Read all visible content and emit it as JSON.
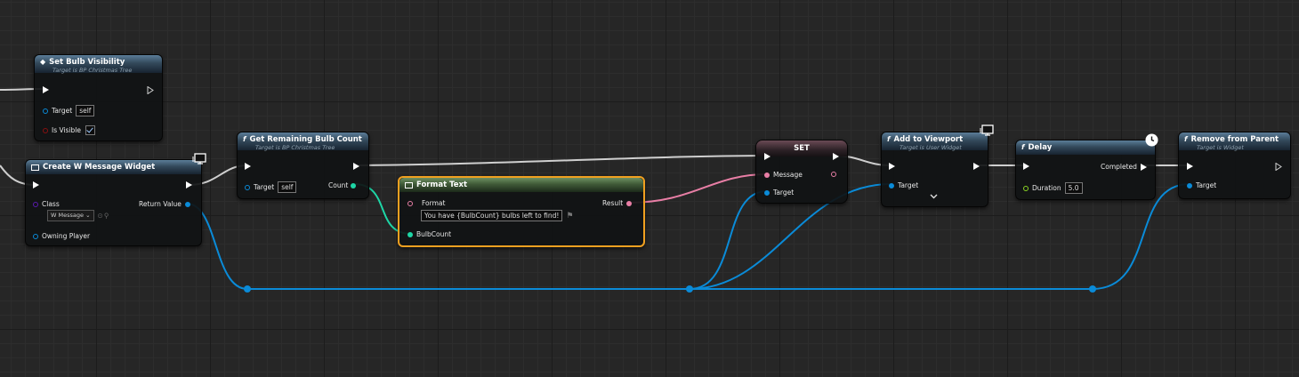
{
  "nodes": {
    "set_bulb_visibility": {
      "title": "Set Bulb Visibility",
      "subtitle": "Target is BP Christmas Tree",
      "target_label": "Target",
      "target_value": "self",
      "visible_label": "Is Visible"
    },
    "create_widget": {
      "title": "Create W Message Widget",
      "class_label": "Class",
      "class_value": "W Message",
      "return_label": "Return Value",
      "owning_label": "Owning Player"
    },
    "get_remaining": {
      "title": "Get Remaining Bulb Count",
      "subtitle": "Target is BP Christmas Tree",
      "target_label": "Target",
      "target_value": "self",
      "count_label": "Count"
    },
    "format_text": {
      "title": "Format Text",
      "format_label": "Format",
      "format_value": "You have {BulbCount} bulbs left to find!",
      "result_label": "Result",
      "bulbcount_label": "BulbCount"
    },
    "set_node": {
      "title": "SET",
      "message_label": "Message",
      "target_label": "Target"
    },
    "add_to_viewport": {
      "title": "Add to Viewport",
      "subtitle": "Target is User Widget",
      "target_label": "Target"
    },
    "delay": {
      "title": "Delay",
      "completed_label": "Completed",
      "duration_label": "Duration",
      "duration_value": "5.0"
    },
    "remove_from_parent": {
      "title": "Remove from Parent",
      "subtitle": "Target is Widget",
      "target_label": "Target"
    }
  },
  "colors": {
    "exec_wire": "#d0d0d0",
    "object_wire": "#0a8bd8",
    "int_wire": "#1ed6a6",
    "text_wire": "#e87ea5",
    "selection": "#f0a020"
  },
  "icons": [
    "event-diamond-icon",
    "function-icon",
    "widget-icon",
    "monitor-icon",
    "clock-icon",
    "chevron-down-icon",
    "flag-icon",
    "magnifier-icon"
  ]
}
